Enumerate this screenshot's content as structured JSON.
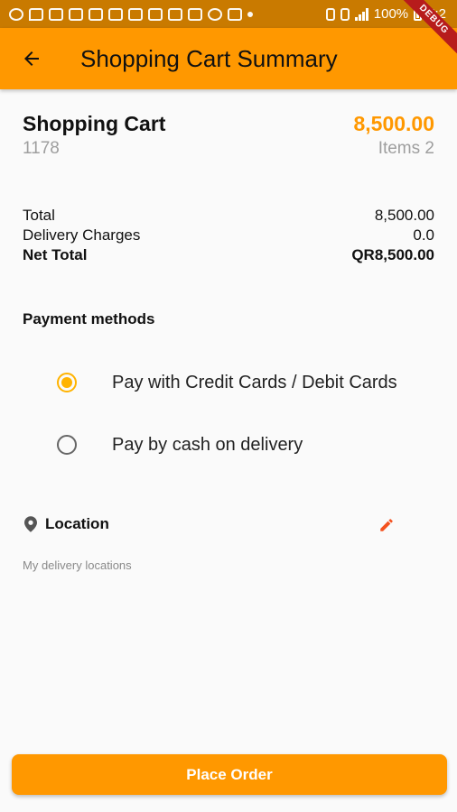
{
  "status_bar": {
    "battery": "100%",
    "time": "5:2"
  },
  "debug_banner": "DEBUG",
  "app_bar": {
    "title": "Shopping Cart Summary"
  },
  "cart": {
    "title": "Shopping Cart",
    "id": "1178",
    "amount": "8,500.00",
    "items": "Items 2"
  },
  "totals": [
    {
      "label": "Total",
      "value": "8,500.00"
    },
    {
      "label": "Delivery Charges",
      "value": "0.0"
    },
    {
      "label": "Net Total",
      "value": "QR8,500.00"
    }
  ],
  "payment": {
    "heading": "Payment methods",
    "options": [
      {
        "label": "Pay with Credit Cards / Debit Cards",
        "selected": true
      },
      {
        "label": "Pay by cash on delivery",
        "selected": false
      }
    ]
  },
  "location": {
    "heading": "Location",
    "subtitle": "My delivery locations"
  },
  "place_order_label": "Place Order",
  "colors": {
    "accent": "#ff9800",
    "status_bar": "#c97a00",
    "radio_selected": "#ffb300",
    "edit_icon": "#f4511e"
  }
}
